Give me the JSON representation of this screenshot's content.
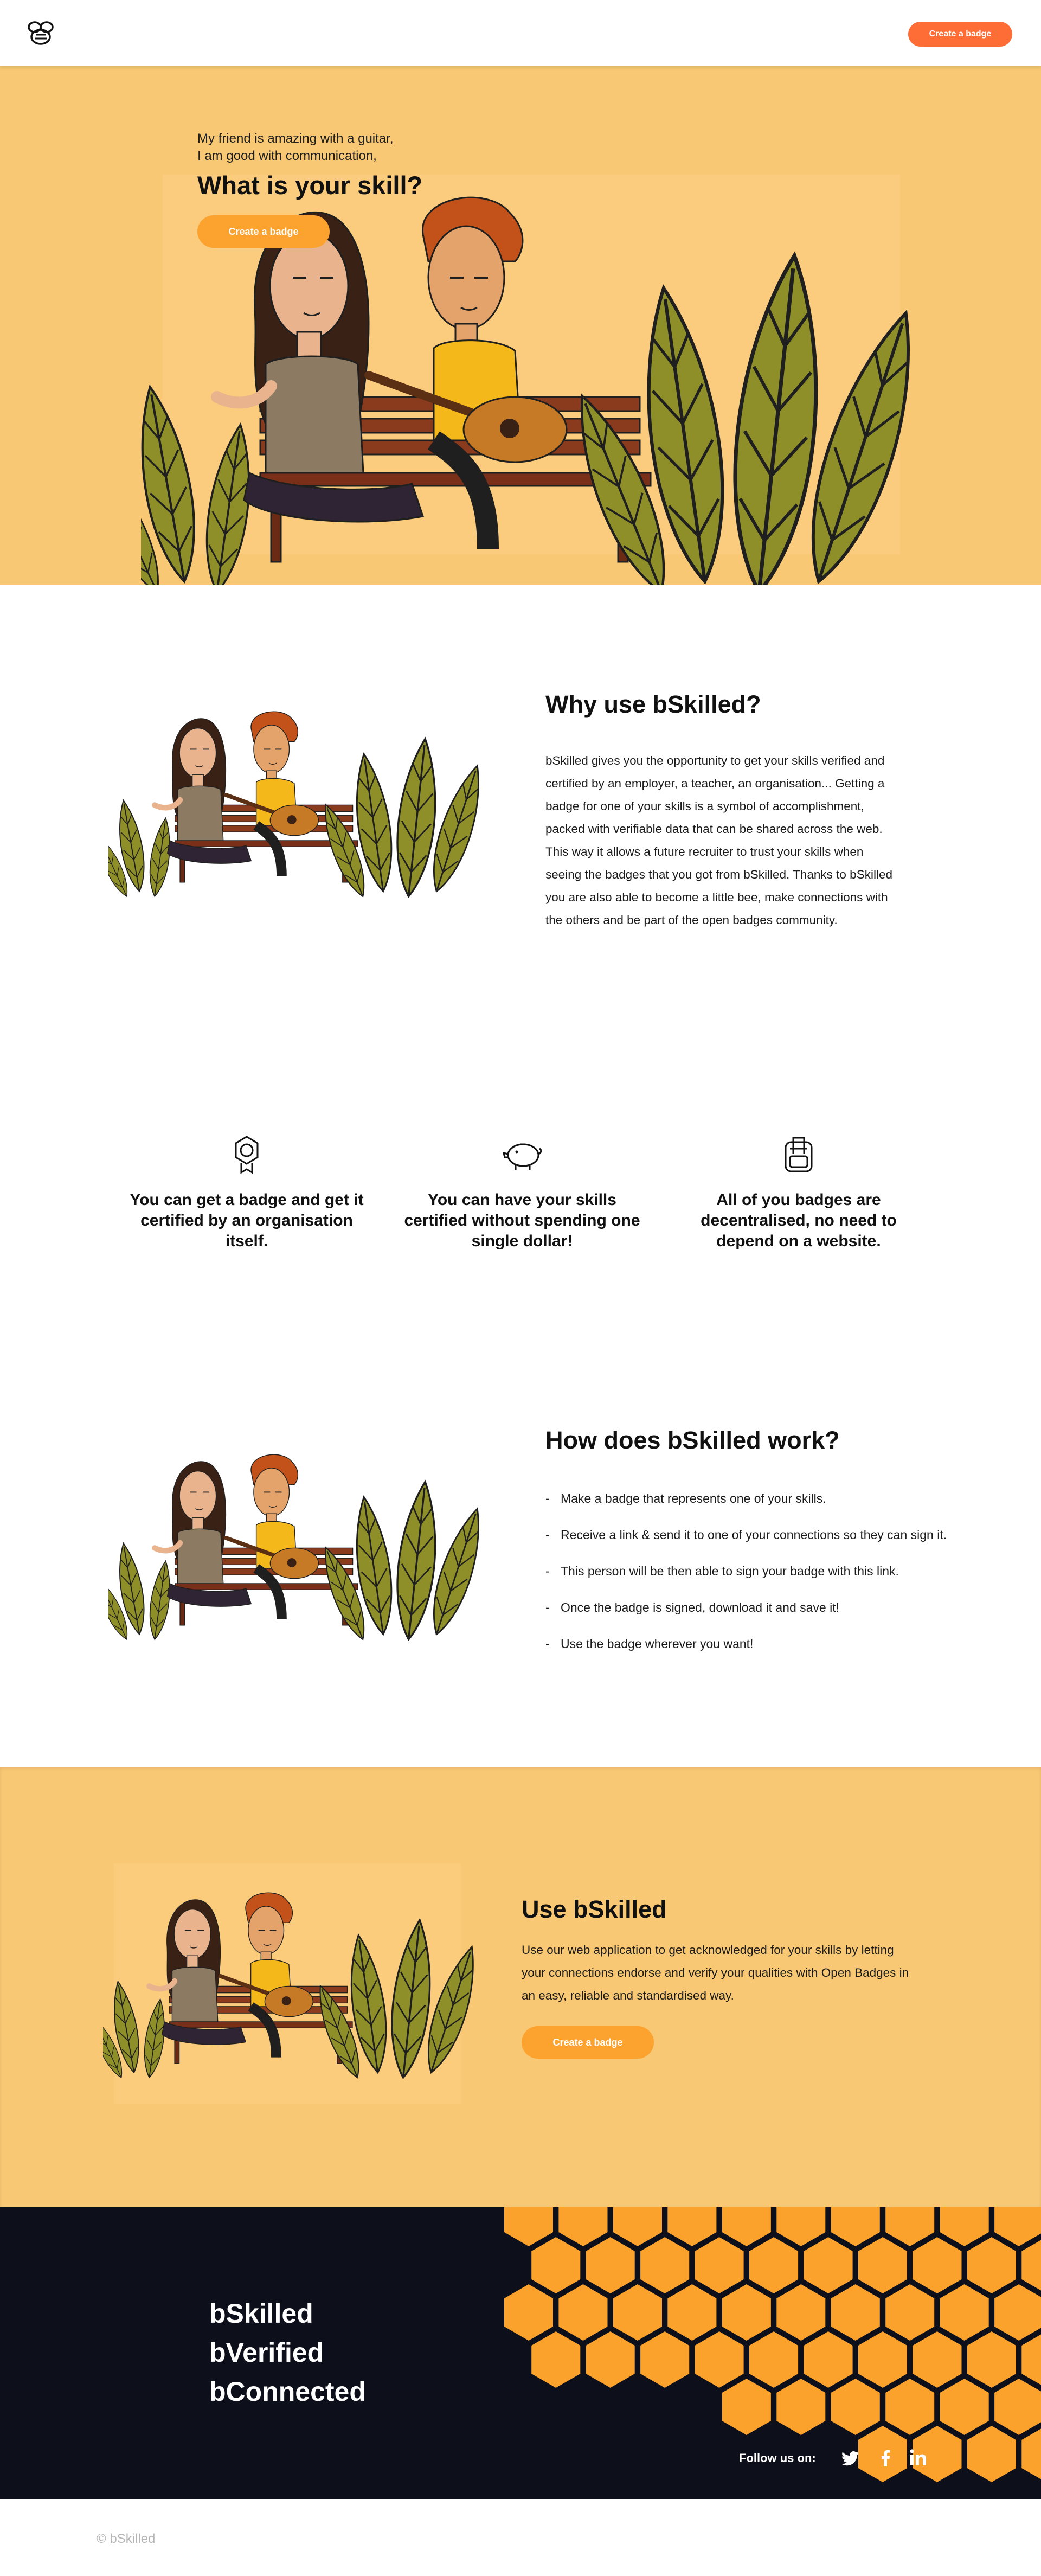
{
  "header": {
    "cta_label": "Create a badge"
  },
  "hero": {
    "line1": "My friend is amazing with a guitar,",
    "line2": "I am good with communication,",
    "question": "What is your skill?",
    "cta_label": "Create a badge"
  },
  "why": {
    "title": "Why use bSkilled?",
    "body": "bSkilled gives you the opportunity to get your skills verified and certified by an employer, a teacher, an organisation... Getting a badge for one of your skills is a symbol of accomplishment, packed with verifiable data that can be shared across the web. This way it allows a future recruiter to trust your skills when seeing the badges that you got from bSkilled. Thanks to bSkilled you are also able to become a little bee, make connections with the others and be part of the open badges community."
  },
  "features": [
    {
      "icon": "badge-award-icon",
      "text": "You can get a badge and get it certified by an organisation itself."
    },
    {
      "icon": "piggy-bank-icon",
      "text": "You can have your skills certified without spending one single dollar!"
    },
    {
      "icon": "backpack-icon",
      "text": "All of you badges are decentralised, no need to depend on a website."
    }
  ],
  "how": {
    "title": "How does bSkilled work?",
    "steps": [
      "Make a badge that represents one of your skills.",
      "Receive a link & send it to one of your connections so they can sign it.",
      "This person will be then able to sign your badge with this link.",
      "Once the badge is signed, download it and save it!",
      "Use the badge wherever you want!"
    ],
    "bullet": "-"
  },
  "use": {
    "title": "Use bSkilled",
    "body": "Use our web application to get acknowledged for your skills by letting your connections endorse and verify your qualities with Open Badges in an easy, reliable and standardised way.",
    "cta_label": "Create a badge"
  },
  "footer": {
    "tagline": [
      "bSkilled",
      "bVerified",
      "bConnected"
    ],
    "follow_label": "Follow us on:",
    "social_icons": [
      "twitter-icon",
      "facebook-icon",
      "linkedin-icon"
    ],
    "copyright": "© bSkilled"
  },
  "colors": {
    "accent": "#fe6d36",
    "button": "#fca22e",
    "section_bg": "#f9c874",
    "footer_bg": "#0d0f1a",
    "honeycomb": "#fba22d"
  }
}
